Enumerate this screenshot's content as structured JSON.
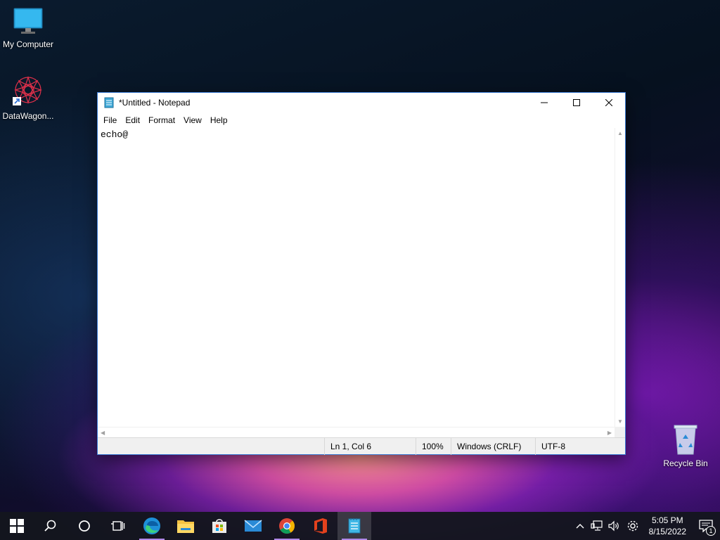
{
  "desktop": {
    "icons": [
      {
        "label": "My Computer",
        "icon": "monitor-icon"
      },
      {
        "label": "DataWagon...",
        "icon": "datawagon-shortcut-icon"
      },
      {
        "label": "Recycle Bin",
        "icon": "recycle-bin-icon"
      }
    ]
  },
  "notepad": {
    "title": "*Untitled - Notepad",
    "menu": [
      "File",
      "Edit",
      "Format",
      "View",
      "Help"
    ],
    "content": "echo@",
    "status": {
      "position": "Ln 1, Col 6",
      "zoom": "100%",
      "line_ending": "Windows (CRLF)",
      "encoding": "UTF-8"
    }
  },
  "taskbar": {
    "apps": [
      "start-icon",
      "search-icon",
      "cortana-icon",
      "task-view-icon",
      "edge-icon",
      "file-explorer-icon",
      "store-icon",
      "mail-icon",
      "chrome-icon",
      "office-icon",
      "notepad-icon"
    ],
    "time": "5:05 PM",
    "date": "8/15/2022",
    "notification_count": "1"
  },
  "colors": {
    "accent": "#3a7bd5",
    "taskbar": "#14161e",
    "active_underline": "#b089e8"
  }
}
